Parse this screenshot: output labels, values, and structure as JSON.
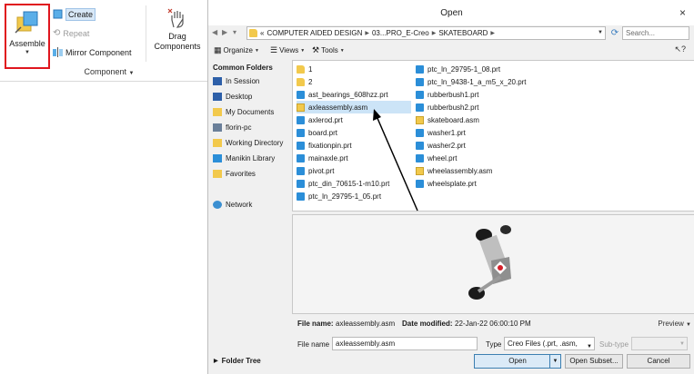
{
  "ribbon": {
    "assemble_label": "Assemble",
    "create_label": "Create",
    "repeat_label": "Repeat",
    "mirror_label": "Mirror Component",
    "drag_label_1": "Drag",
    "drag_label_2": "Components",
    "group_label": "Component"
  },
  "dialog": {
    "title": "Open",
    "close": "×",
    "breadcrumb": [
      "COMPUTER AIDED DESIGN",
      "03...PRO_E-Creo",
      "SKATEBOARD"
    ],
    "search_placeholder": "Search...",
    "toolbar": {
      "organize": "Organize",
      "views": "Views",
      "tools": "Tools"
    },
    "sidebar": {
      "heading": "Common Folders",
      "items": [
        "In Session",
        "Desktop",
        "My Documents",
        "florin-pc",
        "Working Directory",
        "Manikin Library",
        "Favorites",
        "Network"
      ]
    },
    "files_col1": [
      "1",
      "2",
      "ast_bearings_608hzz.prt",
      "axleassembly.asm",
      "axlerod.prt",
      "board.prt",
      "fixationpin.prt",
      "mainaxle.prt",
      "pivot.prt",
      "ptc_din_70615-1-m10.prt",
      "ptc_ln_29795-1_05.prt"
    ],
    "files_col2": [
      "ptc_ln_29795-1_08.prt",
      "ptc_ln_9438-1_a_m5_x_20.prt",
      "rubberbush1.prt",
      "rubberbush2.prt",
      "skateboard.asm",
      "washer1.prt",
      "washer2.prt",
      "wheel.prt",
      "wheelassembly.asm",
      "wheelsplate.prt"
    ],
    "selected_file": "axleassembly.asm",
    "status": {
      "file_name_label": "File name:",
      "file_name_value": "axleassembly.asm",
      "date_label": "Date modified:",
      "date_value": "22-Jan-22 06:00:10 PM",
      "preview_label": "Preview"
    },
    "bottom": {
      "file_name_label": "File name",
      "file_name_value": "axleassembly.asm",
      "type_label": "Type",
      "type_value": "Creo Files (.prt, .asm,",
      "subtype_label": "Sub-type",
      "folder_tree": "Folder Tree",
      "open": "Open",
      "open_subset": "Open Subset...",
      "cancel": "Cancel"
    }
  },
  "colors": {
    "highlight_red": "#e0161e",
    "selection_blue": "#cce4f7",
    "prt_icon": "#2b8ed8",
    "asm_icon": "#f2c94c"
  }
}
